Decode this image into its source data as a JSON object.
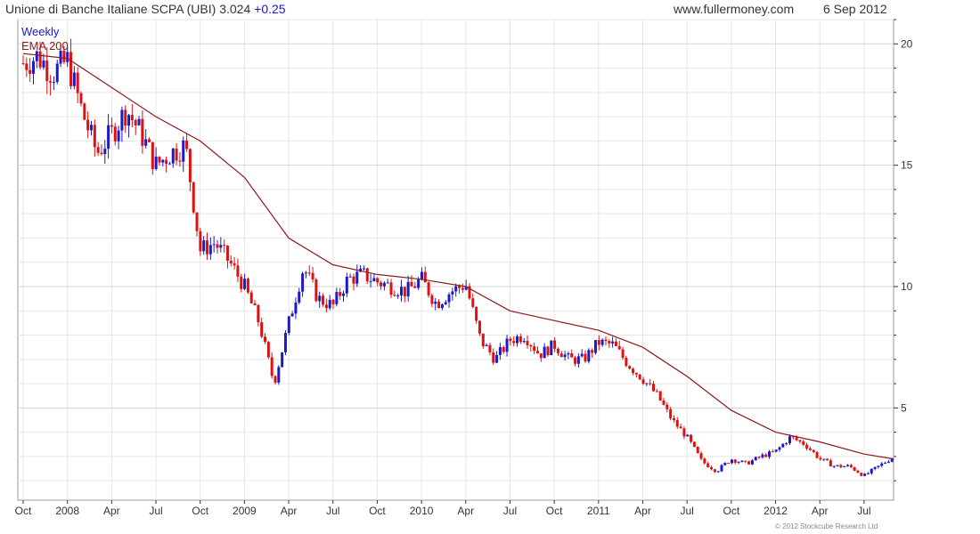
{
  "header": {
    "title": "Unione di Banche Italiane SCPA (UBI) 3.024",
    "change": "+0.25",
    "website": "www.fullermoney.com",
    "date": "6 Sep 2012"
  },
  "legend": {
    "items": [
      "Weekly",
      "EMA 200"
    ]
  },
  "footer": {
    "copyright": "© 2012 Stockcube Research Ltd"
  },
  "colors": {
    "up": "#1a1acc",
    "down": "#dd1111",
    "ema": "#8b1a1a",
    "grid": "#e6e6e6",
    "axis": "#333333"
  },
  "chart_data": {
    "type": "candlestick",
    "title": "Unione di Banche Italiane SCPA (UBI) 3.024 +0.25",
    "frequency": "Weekly",
    "x_tick_labels": [
      "Oct",
      "2008",
      "Apr",
      "Jul",
      "Oct",
      "2009",
      "Apr",
      "Jul",
      "Oct",
      "2010",
      "Apr",
      "Jul",
      "Oct",
      "2011",
      "Apr",
      "Jul",
      "Oct",
      "2012",
      "Apr",
      "Jul"
    ],
    "y_ticks": [
      5,
      10,
      15,
      20
    ],
    "ylim": [
      1.2,
      21
    ],
    "y_axis_position": "right",
    "grid": true,
    "legend_position": "top-left",
    "x_range": [
      "2007-10",
      "2012-09"
    ],
    "price_path": [
      [
        "2007-10",
        19.2
      ],
      [
        "2007-11",
        19.5
      ],
      [
        "2007-12",
        18.8
      ],
      [
        "2008-01",
        19.3
      ],
      [
        "2008-02",
        17.2
      ],
      [
        "2008-03",
        15.5
      ],
      [
        "2008-04",
        16.3
      ],
      [
        "2008-05",
        17.3
      ],
      [
        "2008-06",
        16.3
      ],
      [
        "2008-07",
        15.0
      ],
      [
        "2008-08",
        15.5
      ],
      [
        "2008-09",
        15.8
      ],
      [
        "2008-10",
        11.5
      ],
      [
        "2008-11",
        11.8
      ],
      [
        "2008-12",
        11.0
      ],
      [
        "2009-01",
        10.0
      ],
      [
        "2009-02",
        8.5
      ],
      [
        "2009-03",
        6.0
      ],
      [
        "2009-04",
        8.5
      ],
      [
        "2009-05",
        10.8
      ],
      [
        "2009-06",
        9.5
      ],
      [
        "2009-07",
        9.2
      ],
      [
        "2009-08",
        10.3
      ],
      [
        "2009-09",
        10.5
      ],
      [
        "2009-10",
        10.2
      ],
      [
        "2009-11",
        10.0
      ],
      [
        "2009-12",
        9.8
      ],
      [
        "2010-01",
        10.3
      ],
      [
        "2010-02",
        9.3
      ],
      [
        "2010-03",
        9.8
      ],
      [
        "2010-04",
        10.1
      ],
      [
        "2010-05",
        7.8
      ],
      [
        "2010-06",
        7.0
      ],
      [
        "2010-07",
        7.8
      ],
      [
        "2010-08",
        8.0
      ],
      [
        "2010-09",
        7.2
      ],
      [
        "2010-10",
        7.6
      ],
      [
        "2010-11",
        7.0
      ],
      [
        "2010-12",
        7.0
      ],
      [
        "2011-01",
        7.7
      ],
      [
        "2011-02",
        7.6
      ],
      [
        "2011-03",
        6.8
      ],
      [
        "2011-04",
        6.2
      ],
      [
        "2011-05",
        5.5
      ],
      [
        "2011-06",
        4.5
      ],
      [
        "2011-07",
        3.8
      ],
      [
        "2011-08",
        2.8
      ],
      [
        "2011-09",
        2.4
      ],
      [
        "2011-10",
        2.9
      ],
      [
        "2011-11",
        2.7
      ],
      [
        "2011-12",
        3.0
      ],
      [
        "2012-01",
        3.2
      ],
      [
        "2012-02",
        3.8
      ],
      [
        "2012-03",
        3.5
      ],
      [
        "2012-04",
        2.9
      ],
      [
        "2012-05",
        2.6
      ],
      [
        "2012-06",
        2.6
      ],
      [
        "2012-07",
        2.2
      ],
      [
        "2012-08",
        2.6
      ],
      [
        "2012-09",
        3.0
      ]
    ],
    "series": [
      {
        "name": "EMA 200",
        "points": [
          [
            "2007-10",
            19.6
          ],
          [
            "2008-01",
            19.4
          ],
          [
            "2008-04",
            18.2
          ],
          [
            "2008-07",
            17.0
          ],
          [
            "2008-10",
            16.0
          ],
          [
            "2009-01",
            14.5
          ],
          [
            "2009-04",
            12.0
          ],
          [
            "2009-07",
            10.9
          ],
          [
            "2009-10",
            10.5
          ],
          [
            "2010-01",
            10.3
          ],
          [
            "2010-04",
            10.0
          ],
          [
            "2010-07",
            9.0
          ],
          [
            "2010-10",
            8.6
          ],
          [
            "2011-01",
            8.2
          ],
          [
            "2011-04",
            7.5
          ],
          [
            "2011-07",
            6.3
          ],
          [
            "2011-10",
            4.9
          ],
          [
            "2012-01",
            4.0
          ],
          [
            "2012-04",
            3.6
          ],
          [
            "2012-07",
            3.1
          ],
          [
            "2012-09",
            2.9
          ]
        ]
      }
    ]
  }
}
